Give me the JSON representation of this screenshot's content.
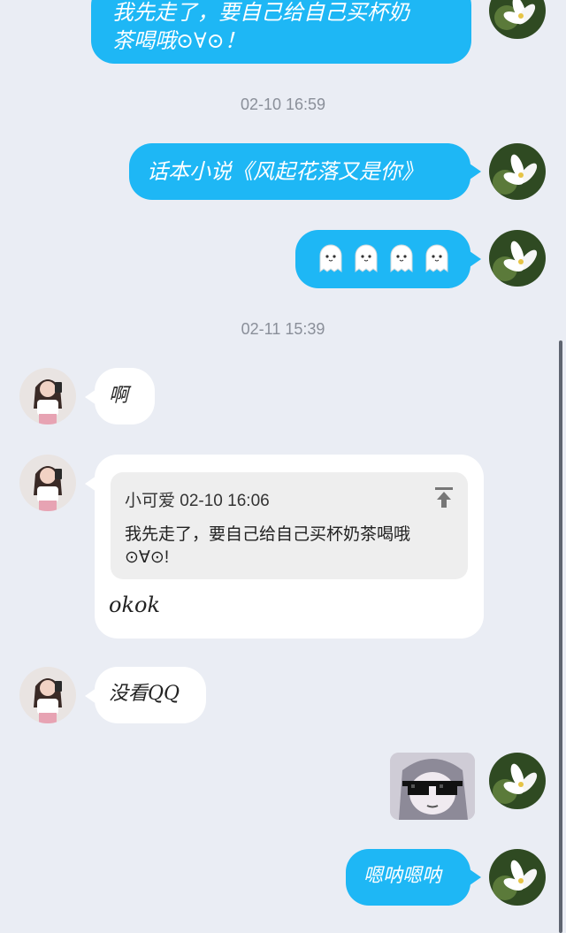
{
  "messages": {
    "m1_text_line1": "我先走了，要自己给自己买杯奶",
    "m1_text_line2": "茶喝哦⊙∀⊙！",
    "ts1": "02-10 16:59",
    "m2_text": "话本小说《风起花落又是你》",
    "m3_emoji": "ghost-emoji x4",
    "ts2": "02-11 15:39",
    "m4_text": "啊",
    "m5_quote_header": "小可爱 02-10 16:06",
    "m5_quote_line1": "我先走了，要自己给自己买杯奶茶喝哦",
    "m5_quote_line2": "⊙∀⊙!",
    "m5_reply": "okok",
    "m6_text": "没看QQ",
    "m7_sticker": "sunglasses-anime-sticker",
    "m8_text": "嗯呐嗯呐"
  },
  "colors": {
    "background": "#eaedf4",
    "my_bubble": "#1eb7f5",
    "their_bubble": "#ffffff",
    "timestamp": "#8a8f99",
    "quote_box": "#eeeeee"
  },
  "icons": {
    "quote_jump": "arrow-to-top-icon",
    "my_avatar": "white-flower-avatar",
    "their_avatar": "girl-photo-avatar"
  }
}
